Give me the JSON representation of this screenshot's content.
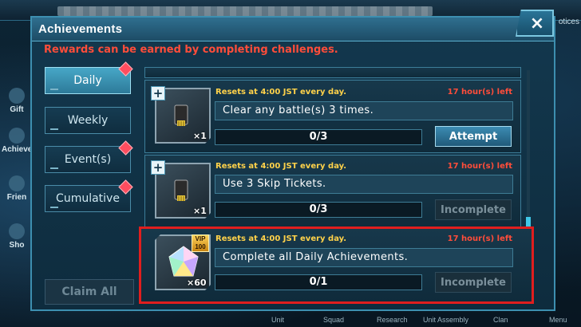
{
  "background": {
    "left_menu": [
      "Gift",
      "Achieve",
      "Frien",
      "Sho"
    ],
    "right_label": "otices",
    "bottom_nav": [
      "Unit",
      "Squad",
      "Research",
      "Unit Assembly",
      "Clan",
      "Menu"
    ]
  },
  "dialog": {
    "title": "Achievements",
    "subtitle": "Rewards can be earned by completing challenges.",
    "close_icon": "×"
  },
  "tabs": [
    {
      "label": "Daily",
      "active": true,
      "badge": true
    },
    {
      "label": "Weekly",
      "active": false,
      "badge": false
    },
    {
      "label": "Event(s)",
      "active": false,
      "badge": true
    },
    {
      "label": "Cumulative",
      "active": false,
      "badge": true
    }
  ],
  "claim_all_label": "Claim All",
  "achievements": [
    {
      "resets": "Resets at 4:00 JST every day.",
      "time_left": "17 hour(s) left",
      "description": "Clear any battle(s) 3 times.",
      "progress": "0/3",
      "reward_icon": "skip-ticket-icon",
      "reward_qty": "×1",
      "action": "Attempt"
    },
    {
      "resets": "Resets at 4:00 JST every day.",
      "time_left": "17 hour(s) left",
      "description": "Use 3 Skip Tickets.",
      "progress": "0/3",
      "reward_icon": "skip-ticket-icon",
      "reward_qty": "×1",
      "action": "Incomplete"
    },
    {
      "resets": "Resets at 4:00 JST every day.",
      "time_left": "17 hour(s) left",
      "description": "Complete all Daily Achievements.",
      "progress": "0/1",
      "reward_icon": "crystal-icon",
      "reward_qty": "×60",
      "vip": "VIP",
      "vip_level": "100",
      "action": "Incomplete"
    }
  ],
  "colors": {
    "accent": "#40c8e8",
    "alert": "#ff4d3a",
    "resets": "#ffd24a",
    "highlight": "#e01e1e"
  }
}
